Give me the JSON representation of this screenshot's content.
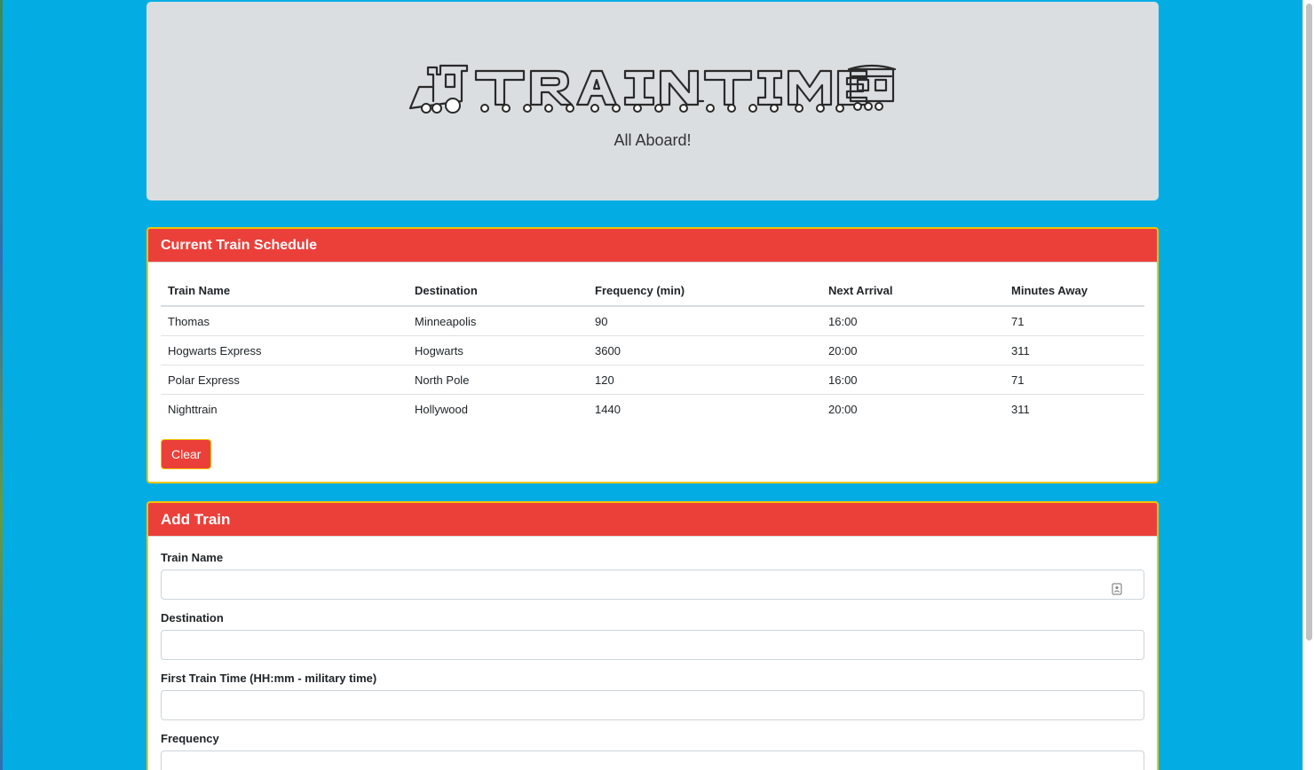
{
  "header": {
    "logo_text": "TRAIN TIME",
    "tagline": "All Aboard!"
  },
  "schedule": {
    "title": "Current Train Schedule",
    "columns": [
      "Train Name",
      "Destination",
      "Frequency (min)",
      "Next Arrival",
      "Minutes Away"
    ],
    "rows": [
      [
        "Thomas",
        "Minneapolis",
        "90",
        "16:00",
        "71"
      ],
      [
        "Hogwarts Express",
        "Hogwarts",
        "3600",
        "20:00",
        "311"
      ],
      [
        "Polar Express",
        "North Pole",
        "120",
        "16:00",
        "71"
      ],
      [
        "Nighttrain",
        "Hollywood",
        "1440",
        "20:00",
        "311"
      ]
    ],
    "clear_label": "Clear"
  },
  "add_train": {
    "title": "Add Train",
    "fields": [
      {
        "label": "Train Name",
        "value": "",
        "icon": "contact-card-icon"
      },
      {
        "label": "Destination",
        "value": ""
      },
      {
        "label": "First Train Time (HH:mm - military time)",
        "value": ""
      },
      {
        "label": "Frequency",
        "value": ""
      }
    ]
  },
  "colors": {
    "background": "#03ade3",
    "accent": "#eb403a",
    "border": "#f2c400",
    "jumbotron": "#dadee1"
  }
}
